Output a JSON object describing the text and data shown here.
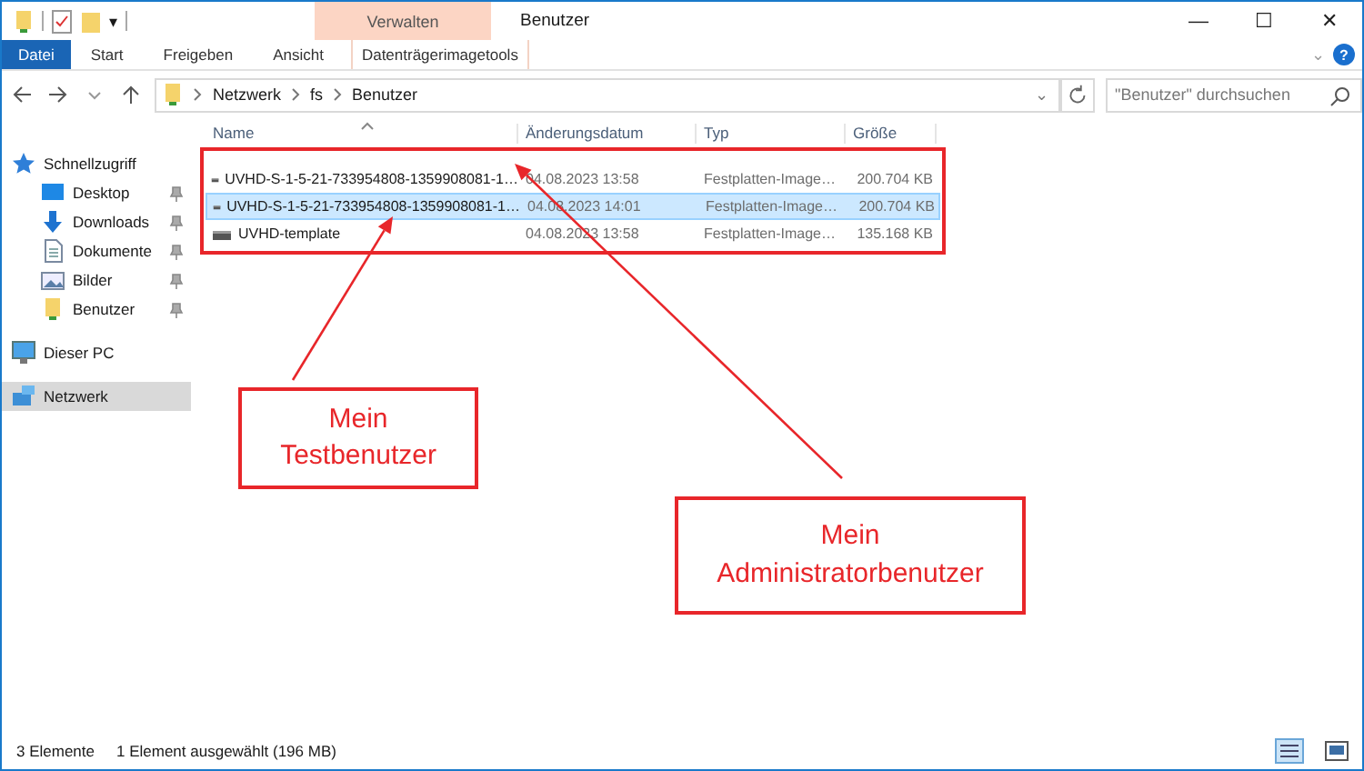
{
  "window": {
    "title": "Benutzer",
    "controls": [
      "—",
      "☐",
      "✕"
    ]
  },
  "quick_access": {
    "kind": "qat",
    "caret": "▾"
  },
  "ribbon": {
    "context_group": "Verwalten",
    "tabs": [
      {
        "label": "Datei",
        "kind": "file",
        "selected": false
      },
      {
        "label": "Start",
        "kind": "tab",
        "selected": false
      },
      {
        "label": "Freigeben",
        "kind": "tab",
        "selected": false
      },
      {
        "label": "Ansicht",
        "kind": "tab",
        "selected": false
      },
      {
        "label": "Datenträgerimagetools",
        "kind": "context",
        "selected": false
      }
    ],
    "expand": "⌄",
    "help": "?"
  },
  "address": {
    "path": [
      "Netzwerk",
      "fs",
      "Benutzer"
    ],
    "dropdown": "⌄"
  },
  "search": {
    "placeholder": "\"Benutzer\" durchsuchen"
  },
  "sidebar": {
    "items": [
      {
        "label": "Schnellzugriff",
        "kind": "star",
        "selected": false,
        "children": [
          {
            "label": "Desktop",
            "kind": "desktop",
            "pinned": true,
            "selected": false
          },
          {
            "label": "Downloads",
            "kind": "download",
            "pinned": true,
            "selected": false
          },
          {
            "label": "Dokumente",
            "kind": "document",
            "pinned": true,
            "selected": false
          },
          {
            "label": "Bilder",
            "kind": "image",
            "pinned": true,
            "selected": false
          },
          {
            "label": "Benutzer",
            "kind": "folder",
            "pinned": true,
            "selected": false
          }
        ]
      },
      {
        "label": "Dieser PC",
        "kind": "pc",
        "selected": false
      },
      {
        "label": "Netzwerk",
        "kind": "network",
        "selected": true
      }
    ]
  },
  "table": {
    "columns": [
      "Name",
      "Änderungsdatum",
      "Typ",
      "Größe"
    ],
    "rows": [
      {
        "name": "UVHD-S-1-5-21-733954808-1359908081-1…",
        "date": "04.08.2023 13:58",
        "type": "Festplatten-Image…",
        "size": "200.704 KB",
        "selected": false
      },
      {
        "name": "UVHD-S-1-5-21-733954808-1359908081-1…",
        "date": "04.08.2023 14:01",
        "type": "Festplatten-Image…",
        "size": "200.704 KB",
        "selected": true
      },
      {
        "name": "UVHD-template",
        "date": "04.08.2023 13:58",
        "type": "Festplatten-Image…",
        "size": "135.168 KB",
        "selected": false
      }
    ]
  },
  "annotations": [
    {
      "text": "Mein Testbenutzer"
    },
    {
      "text": "Mein Administratorbenutzer"
    }
  ],
  "status_bar": {
    "count": "3 Elemente",
    "selection": "1 Element ausgewählt (196 MB)"
  }
}
